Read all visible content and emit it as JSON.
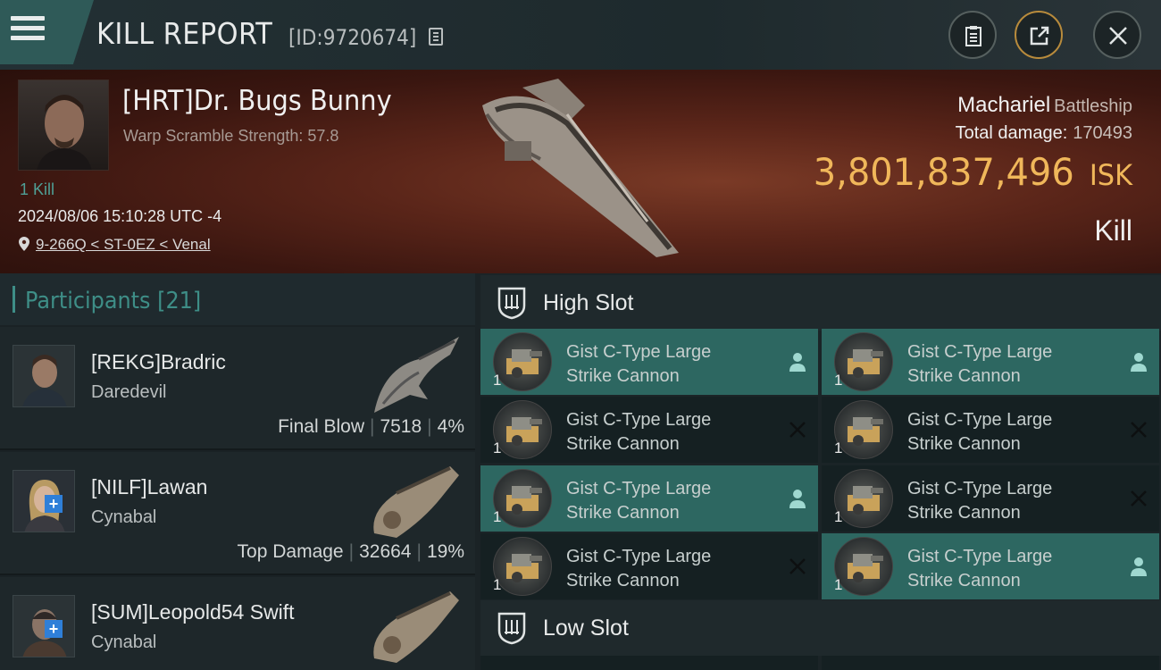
{
  "header": {
    "title": "KILL REPORT",
    "report_id": "[ID:9720674]"
  },
  "victim": {
    "name": "[HRT]Dr. Bugs Bunny",
    "scram": "Warp Scramble Strength: 57.8",
    "kills": "1 Kill",
    "datetime": "2024/08/06 15:10:28 UTC -4",
    "location": "9-266Q < ST-0EZ < Venal",
    "ship": "Machariel",
    "ship_class": "Battleship",
    "damage_label": "Total damage:",
    "damage_value": "170493",
    "isk_value": "3,801,837,496",
    "isk_unit": "ISK",
    "result": "Kill"
  },
  "participants": {
    "title": "Participants",
    "count": "[21]",
    "items": [
      {
        "name": "[REKG]Bradric",
        "ship": "Daredevil",
        "role": "Final Blow",
        "damage": "7518",
        "percent": "4%"
      },
      {
        "name": "[NILF]Lawan",
        "ship": "Cynabal",
        "role": "Top Damage",
        "damage": "32664",
        "percent": "19%"
      },
      {
        "name": "[SUM]Leopold54 Swift",
        "ship": "Cynabal"
      }
    ]
  },
  "slots": {
    "high": "High Slot",
    "low": "Low Slot",
    "modules": [
      {
        "name": "Gist C-Type Large\nStrike Cannon",
        "qty": "1",
        "state": "dropped"
      },
      {
        "name": "Gist C-Type Large\nStrike Cannon",
        "qty": "1",
        "state": "dropped"
      },
      {
        "name": "Gist C-Type Large\nStrike Cannon",
        "qty": "1",
        "state": "destroyed"
      },
      {
        "name": "Gist C-Type Large\nStrike Cannon",
        "qty": "1",
        "state": "destroyed"
      },
      {
        "name": "Gist C-Type Large\nStrike Cannon",
        "qty": "1",
        "state": "dropped"
      },
      {
        "name": "Gist C-Type Large\nStrike Cannon",
        "qty": "1",
        "state": "destroyed"
      },
      {
        "name": "Gist C-Type Large\nStrike Cannon",
        "qty": "1",
        "state": "destroyed"
      },
      {
        "name": "Gist C-Type Large\nStrike Cannon",
        "qty": "1",
        "state": "dropped"
      }
    ]
  },
  "colors": {
    "accent": "#3e8e87",
    "isk": "#f0b75a",
    "dropped_bg": "#2d6761",
    "destroyed_bg": "#152022"
  }
}
